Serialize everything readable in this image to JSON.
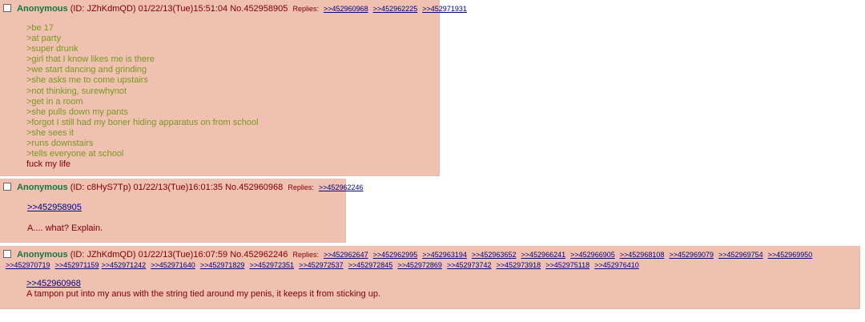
{
  "posts": [
    {
      "name": "Anonymous",
      "meta": "(ID: JZhKdmQD) 01/22/13(Tue)15:51:04 No.452958905",
      "replies_label": "Replies:",
      "backlinks": [
        ">>452960968",
        ">>452962225",
        ">>452971931"
      ],
      "greentext": [
        ">be 17",
        ">at party",
        ">super drunk",
        ">girl that I know likes me is there",
        ">we start dancing and grinding",
        ">she asks me to come upstairs",
        ">not thinking, surewhynot",
        ">get in a room",
        ">she pulls down my pants",
        ">forgot I still had my boner hiding apparatus on from school",
        ">she sees it",
        ">runs downstairs",
        ">tells everyone at school"
      ],
      "closing": "fuck my life"
    },
    {
      "name": "Anonymous",
      "meta": "(ID: c8HyS7Tp) 01/22/13(Tue)16:01:35 No.452960968",
      "replies_label": "Replies:",
      "backlinks": [
        ">>452962246"
      ],
      "quotelink": ">>452958905",
      "text": "A.... what? Explain."
    },
    {
      "name": "Anonymous",
      "meta": "(ID: JZhKdmQD) 01/22/13(Tue)16:07:59 No.452962246",
      "replies_label": "Replies:",
      "backlinks": [
        ">>452962647",
        ">>452962995",
        ">>452963194",
        ">>452963652",
        ">>452966241",
        ">>452966905",
        ">>452968108",
        ">>452969079",
        ">>452969754",
        ">>452969950",
        ">>452970719",
        ">>452971159",
        ">>452971242",
        ">>452971640",
        ">>452971829",
        ">>452972351",
        ">>452972537",
        ">>452972845",
        ">>452972869",
        ">>452973742",
        ">>452973918",
        ">>452975118",
        ">>452976410"
      ],
      "quotelink": ">>452960968",
      "text": "A tampon put into my anus with the string tied around my penis, it keeps it from sticking up."
    }
  ],
  "colors": {
    "post_background": "#f0c0b0",
    "name": "#117743",
    "greentext": "#789922",
    "link": "#000080",
    "text": "#800000"
  }
}
